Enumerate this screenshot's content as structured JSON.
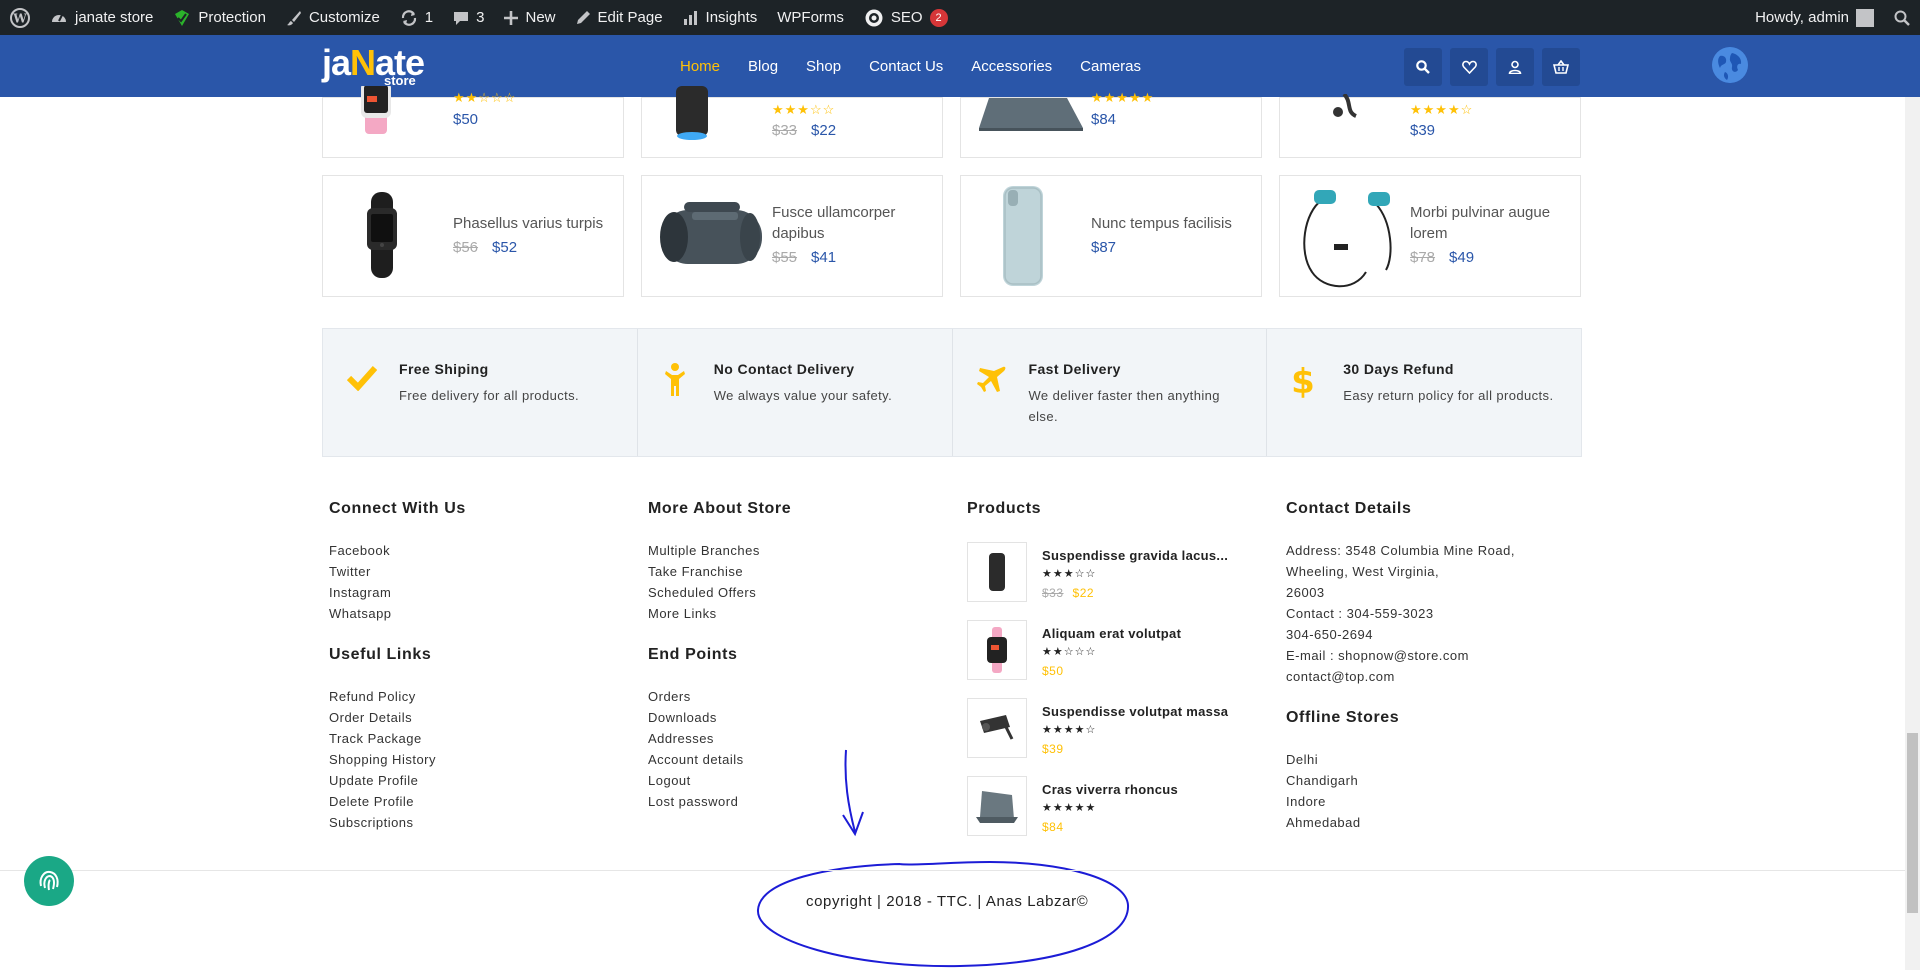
{
  "admin_bar": {
    "site_name": "janate store",
    "protection": "Protection",
    "customize": "Customize",
    "updates_count": "1",
    "comments_count": "3",
    "new_label": "New",
    "edit_page": "Edit Page",
    "insights": "Insights",
    "wpforms": "WPForms",
    "seo": "SEO",
    "seo_badge": "2",
    "howdy": "Howdy, admin"
  },
  "header": {
    "logo_main_a": "ja",
    "logo_main_n": "N",
    "logo_main_b": "ate",
    "logo_sub": "store",
    "nav": [
      "Home",
      "Blog",
      "Shop",
      "Contact Us",
      "Accessories",
      "Cameras"
    ],
    "accent": "#ffc107",
    "brand": "#2a56a9"
  },
  "top_cards": [
    {
      "stars": "★★☆☆☆",
      "old": "",
      "price": "$50"
    },
    {
      "stars": "★★★☆☆",
      "old": "$33",
      "price": "$22"
    },
    {
      "stars": "★★★★★",
      "old": "",
      "price": "$84"
    },
    {
      "stars": "★★★★☆",
      "old": "",
      "price": "$39"
    }
  ],
  "products": [
    {
      "name": "Phasellus varius turpis",
      "old": "$56",
      "price": "$52",
      "icon": "smart-band"
    },
    {
      "name": "Fusce ullamcorper dapibus",
      "old": "$55",
      "price": "$41",
      "icon": "speaker"
    },
    {
      "name": "Nunc tempus facilisis",
      "old": "",
      "price": "$87",
      "icon": "phone-case"
    },
    {
      "name": "Morbi pulvinar augue lorem",
      "old": "$78",
      "price": "$49",
      "icon": "earphones"
    }
  ],
  "features": [
    {
      "title": "Free Shiping",
      "text": "Free delivery for all products.",
      "icon": "check-icon"
    },
    {
      "title": "No Contact Delivery",
      "text": "We always value your safety.",
      "icon": "person-icon"
    },
    {
      "title": "Fast Delivery",
      "text": "We deliver faster then anything else.",
      "icon": "plane-icon"
    },
    {
      "title": "30 Days Refund",
      "text": "Easy return policy for all products.",
      "icon": "dollar-icon"
    }
  ],
  "footer": {
    "connect_title": "Connect With Us",
    "connect": [
      "Facebook",
      "Twitter",
      "Instagram",
      "Whatsapp"
    ],
    "useful_title": "Useful Links",
    "useful": [
      "Refund Policy",
      "Order Details",
      "Track Package",
      "Shopping History",
      "Update Profile",
      "Delete Profile",
      "Subscriptions"
    ],
    "more_title": "More About Store",
    "more": [
      "Multiple Branches",
      "Take Franchise",
      "Scheduled Offers",
      "More Links"
    ],
    "end_title": "End Points",
    "end": [
      "Orders",
      "Downloads",
      "Addresses",
      "Account details",
      "Logout",
      "Lost password"
    ],
    "products_title": "Products",
    "products": [
      {
        "title": "Suspendisse gravida lacus...",
        "stars": "★★★☆☆",
        "old": "$33",
        "price": "$22"
      },
      {
        "title": "Aliquam erat volutpat",
        "stars": "★★☆☆☆",
        "old": "",
        "price": "$50"
      },
      {
        "title": "Suspendisse volutpat massa",
        "stars": "★★★★☆",
        "old": "",
        "price": "$39"
      },
      {
        "title": "Cras viverra rhoncus",
        "stars": "★★★★★",
        "old": "",
        "price": "$84"
      }
    ],
    "contact_title": "Contact Details",
    "contact": [
      "Address: 3548 Columbia Mine Road,",
      "Wheeling, West Virginia,",
      "26003",
      "Contact : 304-559-3023",
      "304-650-2694",
      "E-mail : shopnow@store.com",
      "contact@top.com"
    ],
    "offline_title": "Offline Stores",
    "offline": [
      "Delhi",
      "Chandigarh",
      "Indore",
      "Ahmedabad"
    ]
  },
  "copyright": "copyright | 2018 - TTC. | Anas Labzar©"
}
